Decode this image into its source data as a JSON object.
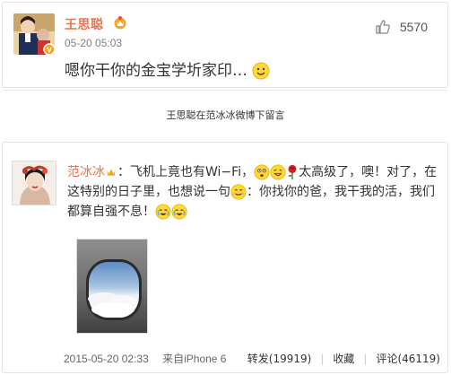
{
  "top_comment": {
    "author": "王思聪",
    "time": "05-20 05:03",
    "content": "嗯你干你的金宝学圻家印…",
    "likes": "5570"
  },
  "caption": "王思聪在范冰冰微博下留言",
  "post": {
    "author": "范冰冰",
    "text_part1": "：飞机上竟也有Wi−Fi，",
    "text_part2": "太高级了，噢！对了，在这特别的日子里，也想说一句",
    "text_part3": "：你找你的爸，我干我的活，我们都算自强不息！",
    "time": "2015-05-20 02:33",
    "source": "来自iPhone 6",
    "repost": "转发(19919)",
    "favorite": "收藏",
    "comment": "评论(46119)"
  },
  "colors": {
    "name": "#eb7350",
    "vip": "#f5a623"
  }
}
